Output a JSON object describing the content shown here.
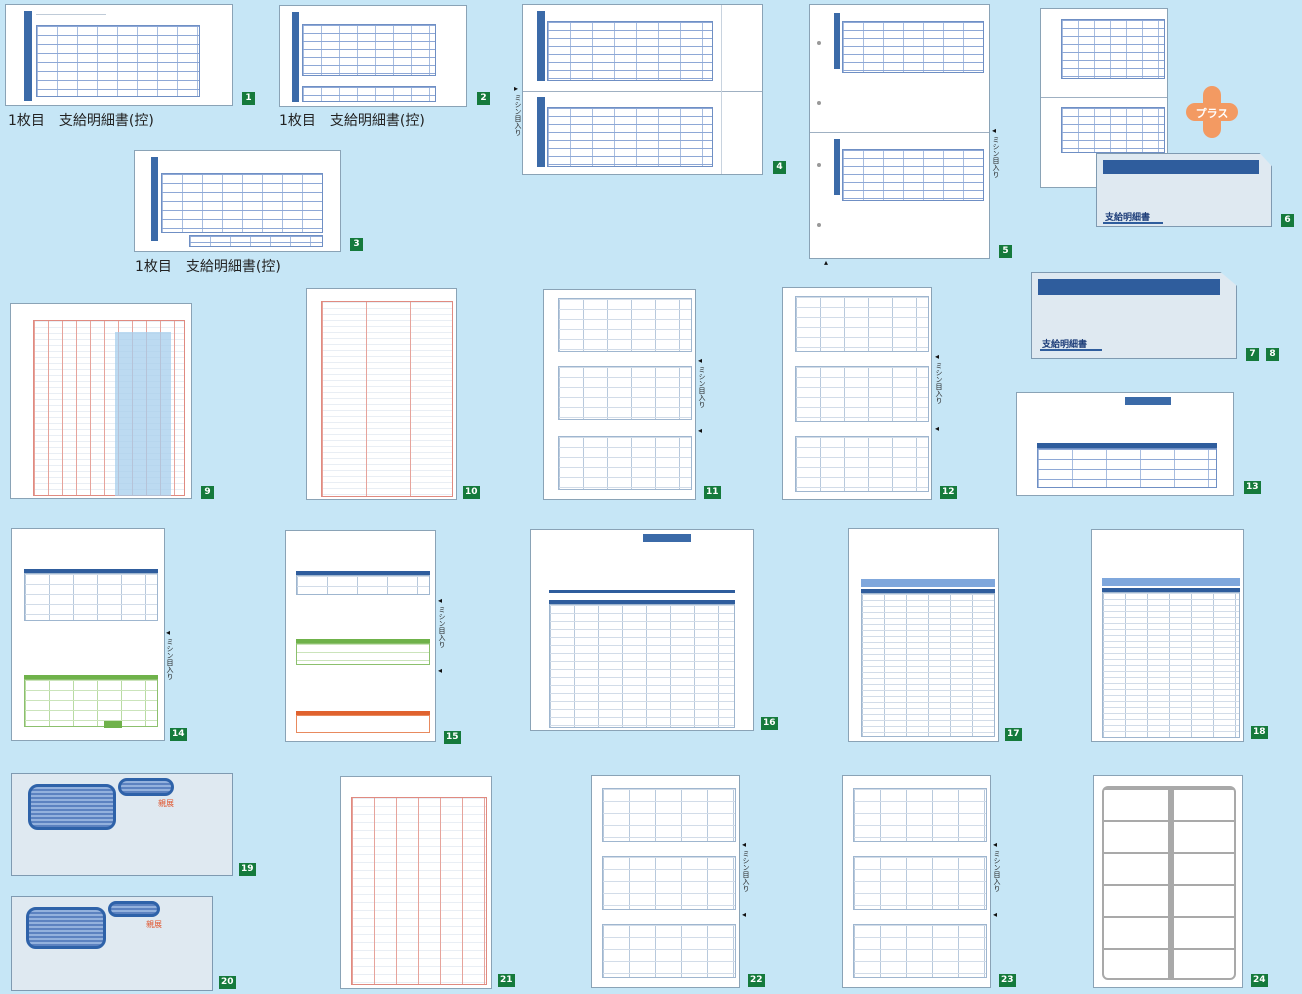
{
  "captions": {
    "c1": "1枚目　支給明細書(控)",
    "c2": "1枚目　支給明細書(控)",
    "c3": "1枚目　支給明細書(控)"
  },
  "perforation_label": "ミシン目入り",
  "plus_label": "プラス",
  "envelope_label": "支給明細書",
  "stamp_label": "親展",
  "badges": [
    "1",
    "2",
    "3",
    "4",
    "5",
    "6",
    "7",
    "8",
    "9",
    "10",
    "11",
    "12",
    "13",
    "14",
    "15",
    "16",
    "17",
    "18",
    "19",
    "20",
    "21",
    "22",
    "23",
    "24"
  ],
  "colors": {
    "background": "#c6e6f6",
    "badge": "#157a3c",
    "form_blue": "#3b6aa8",
    "form_green": "#6fb24a",
    "form_orange": "#e0622e",
    "plus": "#f39a62"
  }
}
